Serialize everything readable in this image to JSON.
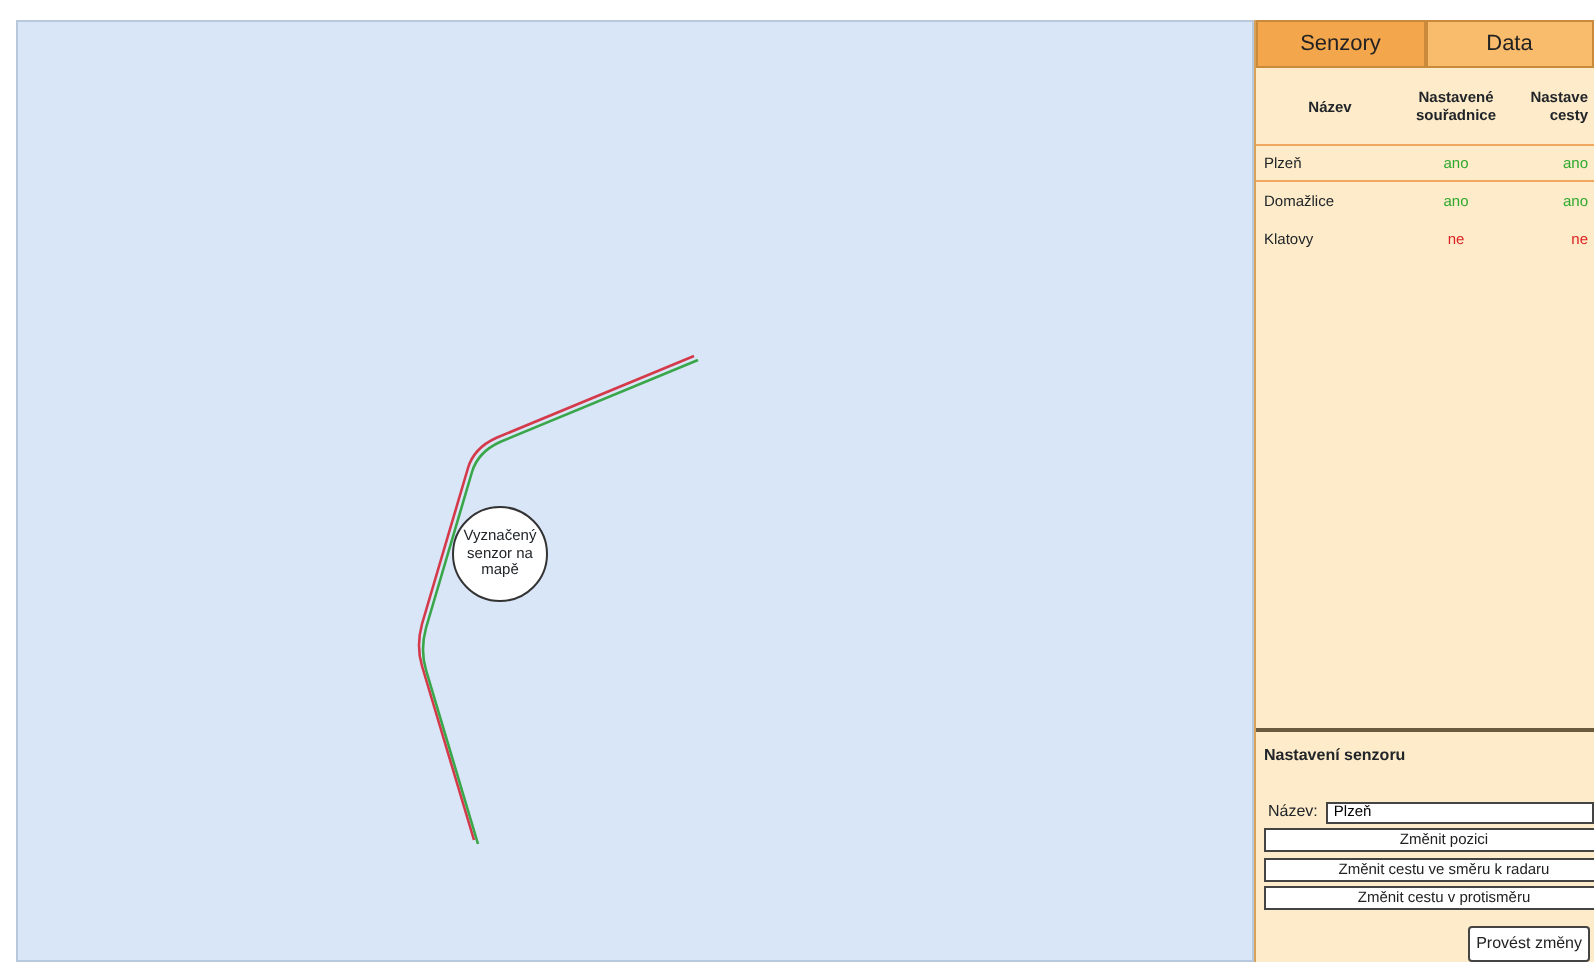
{
  "map": {
    "sensor_label": "Vyznačený senzor na mapě"
  },
  "tabs": [
    {
      "label": "Senzory",
      "selected": true
    },
    {
      "label": "Data",
      "selected": false
    }
  ],
  "table": {
    "columns": [
      "Název",
      "Nastavené souřadnice",
      "Nastave cesty"
    ],
    "rows": [
      {
        "name": "Plzeň",
        "coords": "ano",
        "coords_set": true,
        "path": "ano",
        "path_set": true,
        "selected": true
      },
      {
        "name": "Domažlice",
        "coords": "ano",
        "coords_set": true,
        "path": "ano",
        "path_set": true,
        "selected": false
      },
      {
        "name": "Klatovy",
        "coords": "ne",
        "coords_set": false,
        "path": "ne",
        "path_set": false,
        "selected": false
      }
    ]
  },
  "settings": {
    "title": "Nastavení senzoru",
    "name_label": "Název:",
    "name_value": "Plzeň",
    "buttons": [
      "Změnit pozici",
      "Změnit cestu ve směru k radaru",
      "Změnit cestu v protisměru"
    ],
    "submit": "Provést změny"
  }
}
